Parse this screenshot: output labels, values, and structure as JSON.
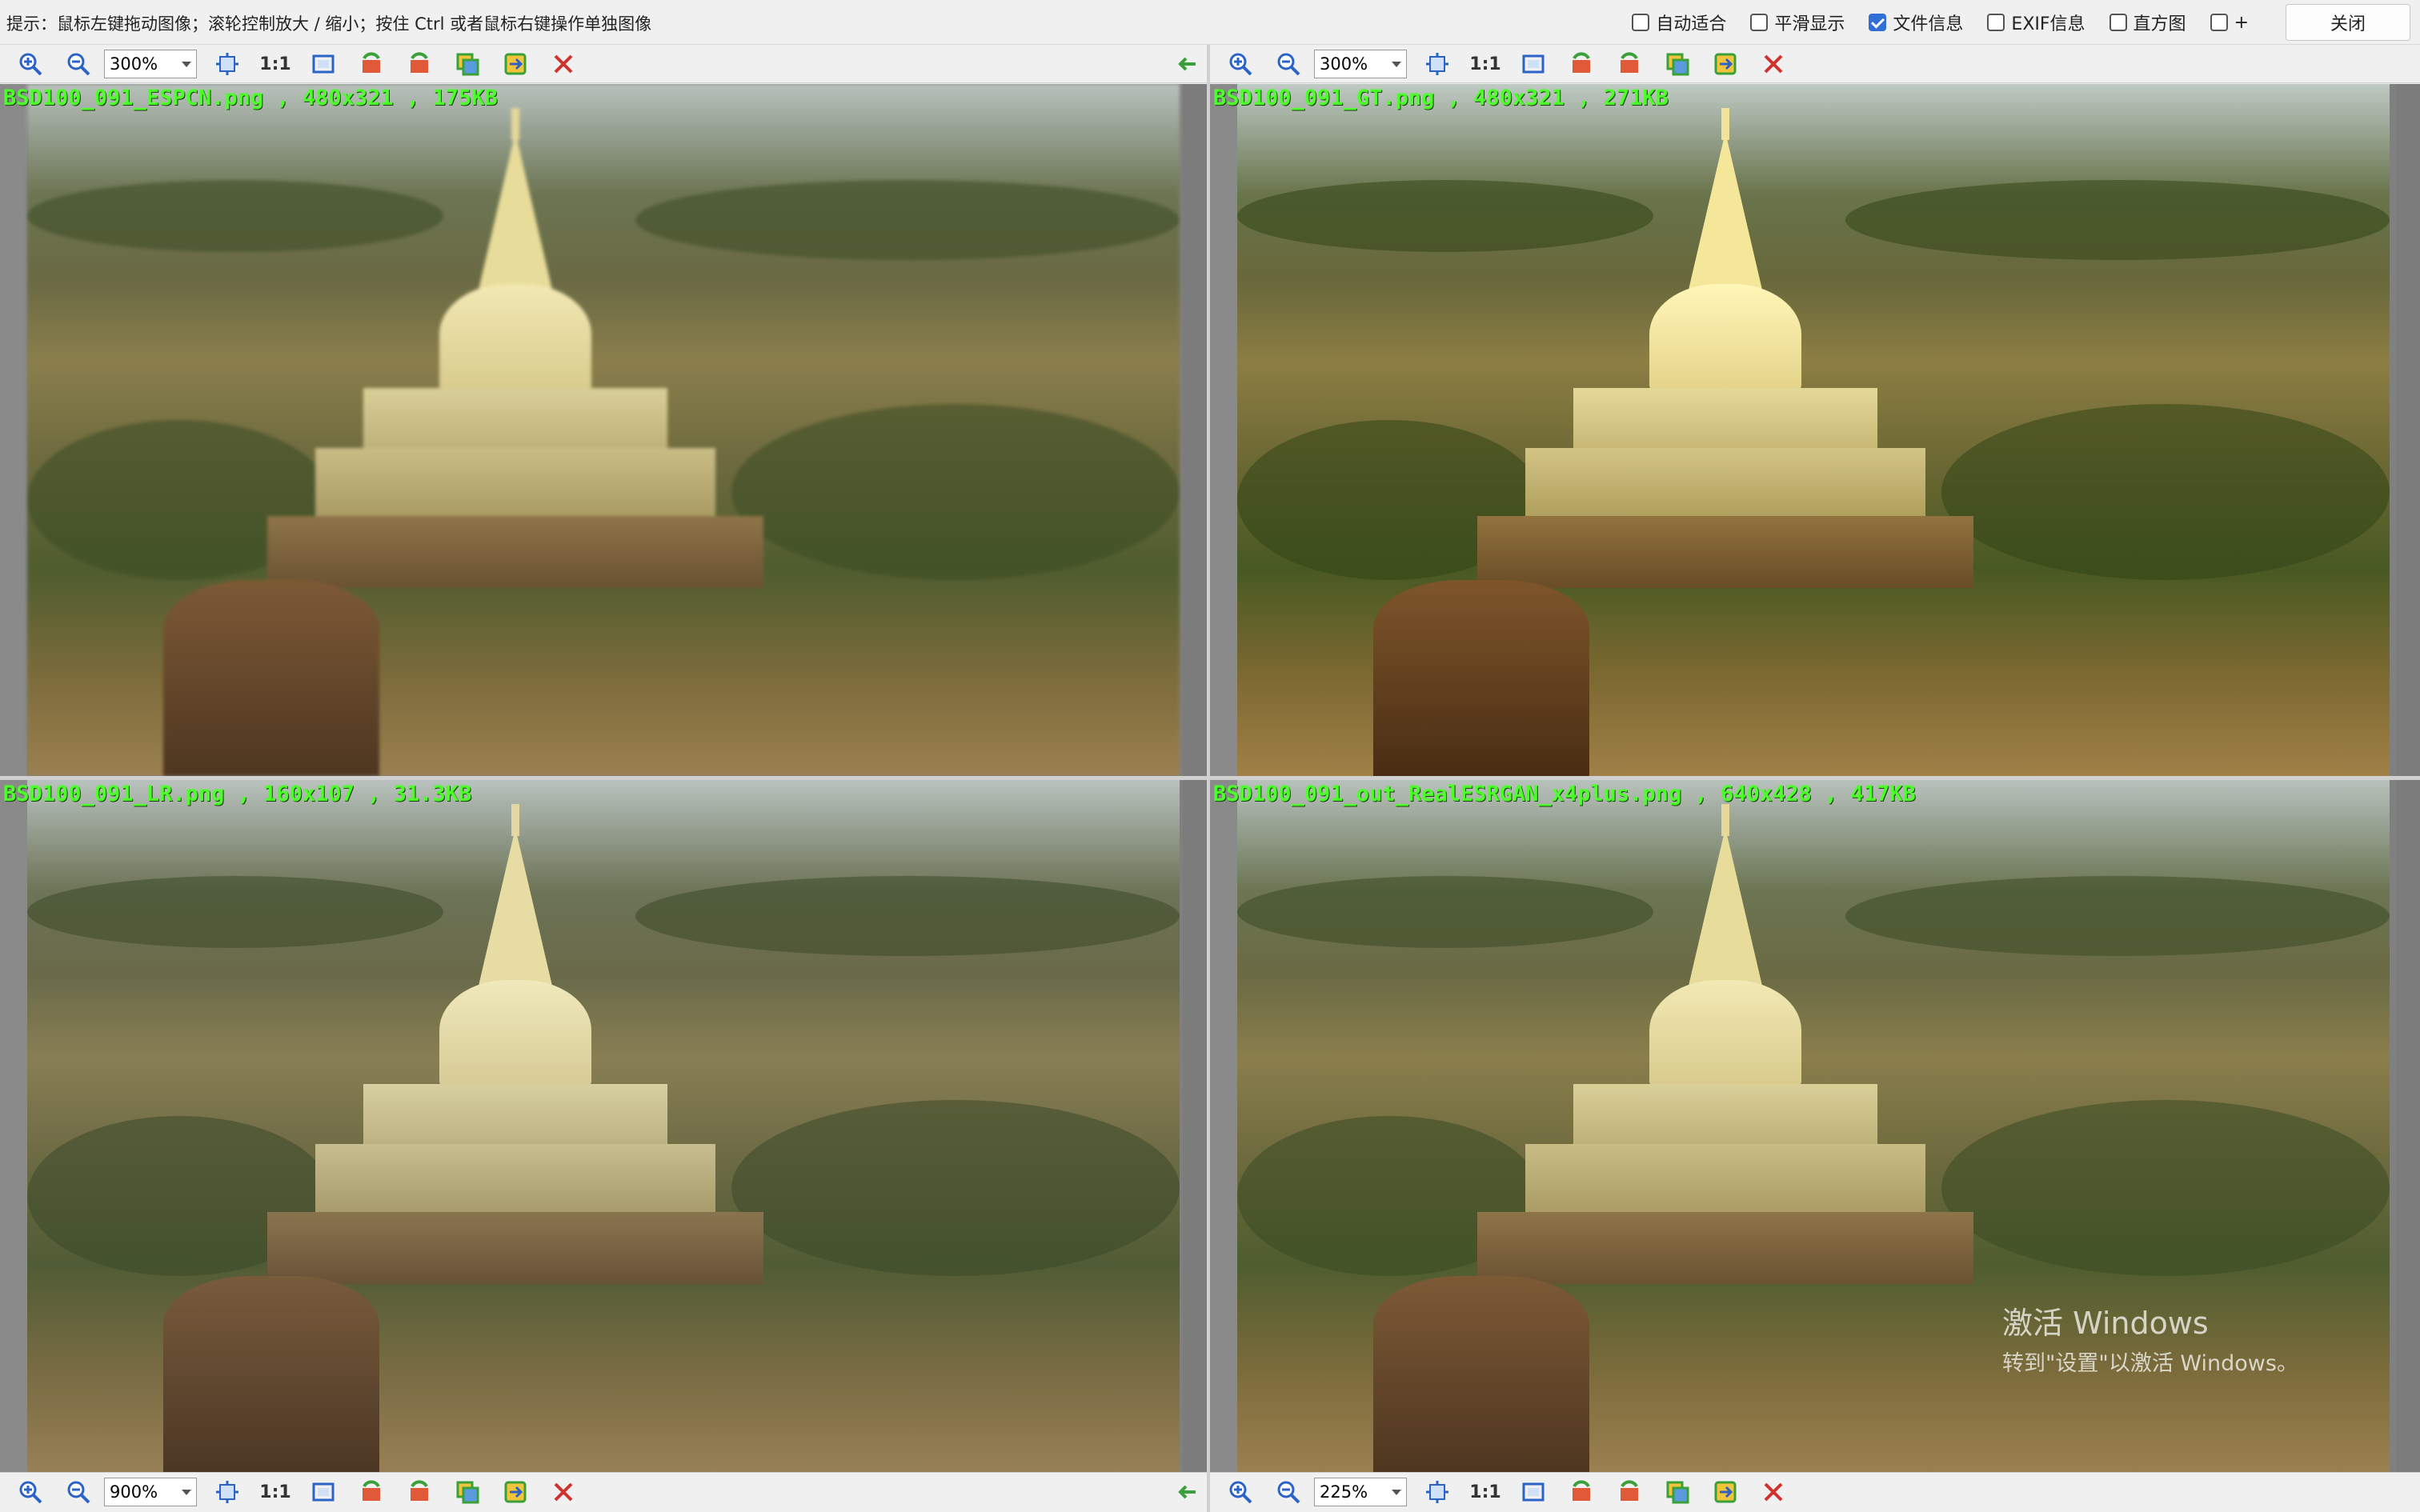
{
  "hint": "提示：鼠标左键拖动图像；滚轮控制放大 / 缩小；按住 Ctrl 或者鼠标右键操作单独图像",
  "options": [
    {
      "label": "自动适合",
      "checked": false
    },
    {
      "label": "平滑显示",
      "checked": false
    },
    {
      "label": "文件信息",
      "checked": true
    },
    {
      "label": "EXIF信息",
      "checked": false
    },
    {
      "label": "直方图",
      "checked": false
    },
    {
      "label": "+",
      "checked": false
    }
  ],
  "close_label": "关闭",
  "one_to_one": "1:1",
  "toolbars": {
    "top_left": {
      "zoom": "300%"
    },
    "top_right": {
      "zoom": "300%"
    },
    "bottom_left": {
      "zoom": "900%"
    },
    "bottom_right": {
      "zoom": "225%"
    }
  },
  "panes": {
    "top_left": {
      "label": "BSD100_091_ESPCN.png , 480x321 , 175KB"
    },
    "top_right": {
      "label": "BSD100_091_GT.png , 480x321 , 271KB"
    },
    "bottom_left": {
      "label": "BSD100_091_LR.png , 160x107 , 31.3KB"
    },
    "bottom_right": {
      "label": "BSD100_091_out_RealESRGAN_x4plus.png , 640x428 , 417KB"
    }
  },
  "watermark": {
    "title": "激活 Windows",
    "subtitle": "转到\"设置\"以激活 Windows。"
  },
  "colors": {
    "file_label": "#4cff2a",
    "checkbox_on": "#2f6fd6",
    "close_x": "#d0312d",
    "icon_blue": "#2b63c9"
  },
  "icons": [
    "zoom-in-icon",
    "zoom-out-icon",
    "fit-icon",
    "one-to-one",
    "full-size-icon",
    "rotate-left-icon",
    "rotate-right-icon",
    "copy-icon",
    "swap-icon",
    "close-x-icon",
    "back-arrow-icon"
  ]
}
